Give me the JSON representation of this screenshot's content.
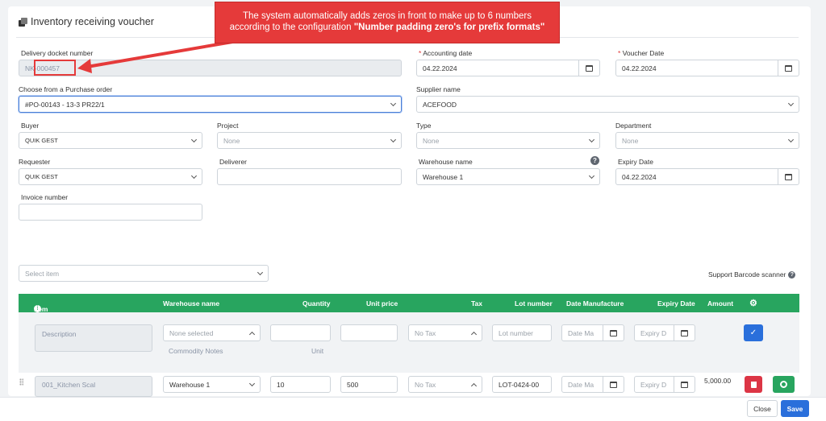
{
  "page": {
    "title": "Inventory receiving voucher"
  },
  "callout": {
    "line1": "The system automatically adds zeros in front to make up to 6 numbers",
    "line2_prefix": "according to the configuration ",
    "line2_bold": "\"Number padding zero's for prefix formats\""
  },
  "form": {
    "delivery_docket": {
      "label": "Delivery docket number",
      "value": "NK-000457"
    },
    "accounting_date": {
      "label": "Accounting date",
      "value": "04.22.2024"
    },
    "voucher_date": {
      "label": "Voucher Date",
      "value": "04.22.2024"
    },
    "purchase_order": {
      "label": "Choose from a Purchase order",
      "value": "#PO-00143 - 13-3 PR22/1"
    },
    "supplier": {
      "label": "Supplier name",
      "value": "ACEFOOD"
    },
    "buyer": {
      "label": "Buyer",
      "value": "QUIK GEST"
    },
    "project": {
      "label": "Project",
      "placeholder": "None"
    },
    "type": {
      "label": "Type",
      "placeholder": "None"
    },
    "department": {
      "label": "Department",
      "placeholder": "None"
    },
    "requester": {
      "label": "Requester",
      "value": "QUIK GEST"
    },
    "deliverer": {
      "label": "Deliverer",
      "value": ""
    },
    "warehouse": {
      "label": "Warehouse name",
      "value": "Warehouse 1",
      "help": "?"
    },
    "expiry_date": {
      "label": "Expiry Date",
      "value": "04.22.2024"
    },
    "invoice": {
      "label": "Invoice number",
      "value": ""
    },
    "required_mark": "*"
  },
  "items": {
    "select_placeholder": "Select item",
    "barcode_label": "Support Barcode scanner",
    "columns": {
      "item": "Item",
      "warehouse": "Warehouse name",
      "quantity": "Quantity",
      "unit_price": "Unit price",
      "tax": "Tax",
      "lot": "Lot number",
      "manufacture": "Date Manufacture",
      "expiry": "Expiry Date",
      "amount": "Amount"
    },
    "new_row": {
      "description_placeholder": "Description",
      "warehouse_placeholder": "None selected",
      "commodity_notes": "Commodity Notes",
      "unit": "Unit",
      "tax": "No Tax",
      "lot_placeholder": "Lot number",
      "manufacture_placeholder": "Date Ma",
      "expiry_placeholder": "Expiry D"
    },
    "rows": [
      {
        "description": "001_Kitchen Scal",
        "warehouse": "Warehouse 1",
        "quantity": "10",
        "unit_price": "500",
        "tax": "No Tax",
        "lot": "LOT-0424-00",
        "manufacture_placeholder": "Date Ma",
        "expiry_placeholder": "Expiry D",
        "amount": "5,000.00"
      }
    ]
  },
  "footer": {
    "close": "Close",
    "save": "Save"
  },
  "colors": {
    "accent_green": "#28a55f",
    "primary_blue": "#2a6fdb",
    "danger_red": "#e53a3a"
  }
}
